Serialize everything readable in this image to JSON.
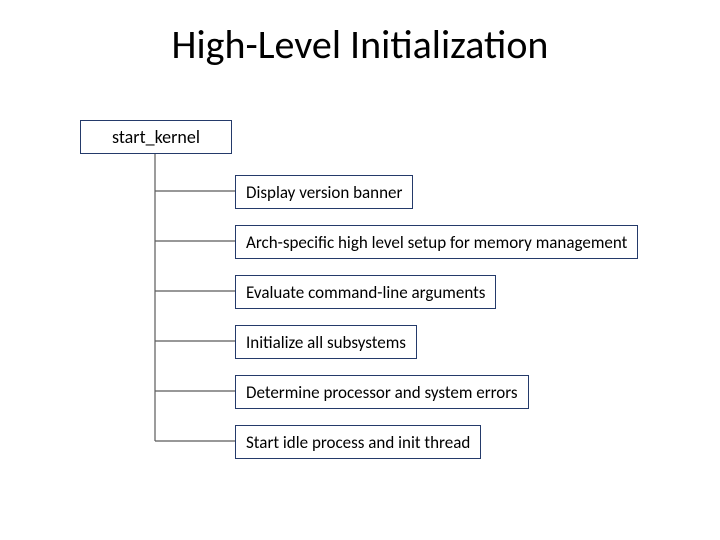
{
  "title": "High-Level Initialization",
  "root": {
    "label": "start_kernel"
  },
  "children": [
    {
      "label": "Display version banner"
    },
    {
      "label": "Arch-specific high level setup for memory management"
    },
    {
      "label": "Evaluate command-line arguments"
    },
    {
      "label": "Initialize all subsystems"
    },
    {
      "label": "Determine processor and system errors"
    },
    {
      "label": "Start idle process and init thread"
    }
  ]
}
